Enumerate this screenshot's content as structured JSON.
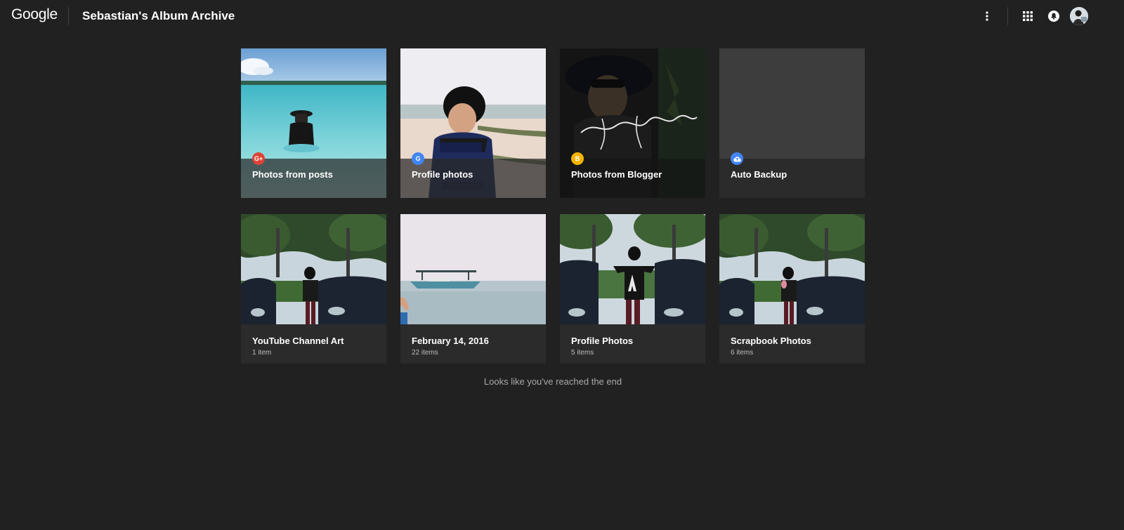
{
  "header": {
    "logo": "Google",
    "title": "Sebastian's Album Archive",
    "icons": [
      "more-vert-icon",
      "apps-grid-icon",
      "notifications-icon",
      "account-avatar"
    ]
  },
  "colors": {
    "background": "#212121",
    "card_footer": "#2b2b2b",
    "google_plus_red": "#db4437",
    "google_blue": "#4285f4",
    "blogger_orange": "#f4b400",
    "backup_blue": "#4285f4"
  },
  "albums": [
    {
      "label": "Photos from posts",
      "count": "",
      "icon": "google-plus-icon"
    },
    {
      "label": "Profile photos",
      "count": "",
      "icon": "google-g-icon"
    },
    {
      "label": "Photos from Blogger",
      "count": "",
      "icon": "blogger-icon"
    },
    {
      "label": "Auto Backup",
      "count": "",
      "icon": "cloud-upload-icon"
    },
    {
      "label": "YouTube Channel Art",
      "count": "1 item",
      "icon": ""
    },
    {
      "label": "February 14, 2016",
      "count": "22 items",
      "icon": ""
    },
    {
      "label": "Profile Photos",
      "count": "5 items",
      "icon": ""
    },
    {
      "label": "Scrapbook Photos",
      "count": "6 items",
      "icon": ""
    }
  ],
  "footer": {
    "end_message": "Looks like you've reached the end"
  }
}
